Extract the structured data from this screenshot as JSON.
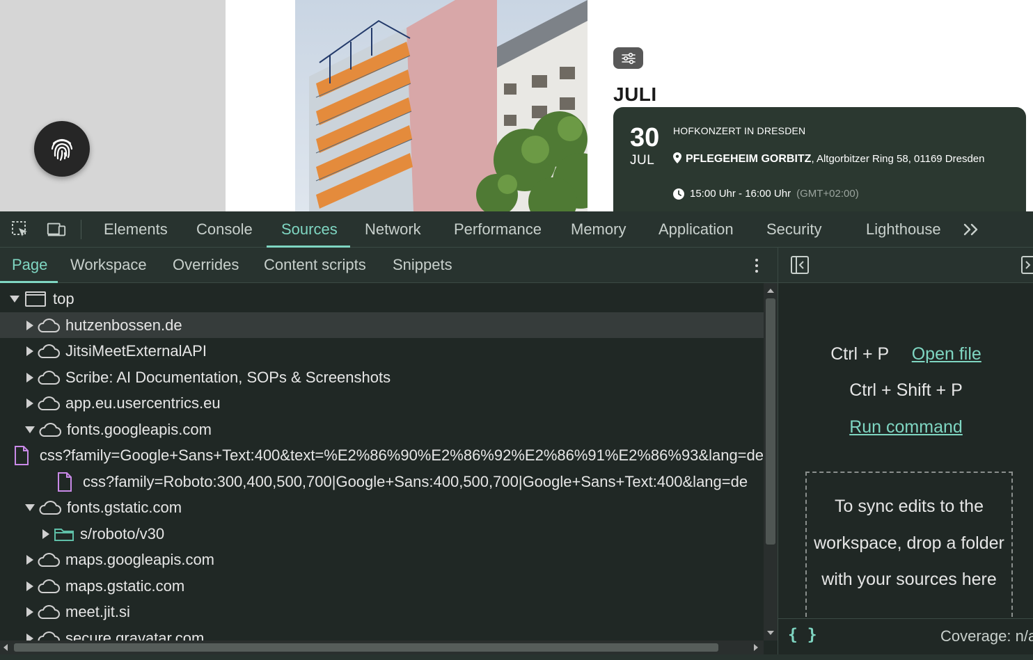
{
  "webpage": {
    "month_heading": "JULI",
    "event": {
      "day": "30",
      "month": "JUL",
      "title": "HOFKONZERT IN DRESDEN",
      "venue": "PFLEGEHEIM GORBITZ",
      "address": ", Altgorbitzer Ring 58, 01169 Dresden",
      "time": "15:00 Uhr - 16:00 Uhr",
      "timezone": "(GMT+02:00)"
    }
  },
  "devtools": {
    "main_tabs": [
      "Elements",
      "Console",
      "Sources",
      "Network",
      "Performance",
      "Memory",
      "Application",
      "Security",
      "Lighthouse"
    ],
    "active_main_tab": "Sources",
    "sub_tabs": [
      "Page",
      "Workspace",
      "Overrides",
      "Content scripts",
      "Snippets"
    ],
    "active_sub_tab": "Page",
    "tree": [
      {
        "label": "top",
        "expand": "down",
        "icon": "frame-icon"
      },
      {
        "label": "hutzenbossen.de",
        "expand": "right",
        "icon": "cloud-icon",
        "selected": true
      },
      {
        "label": "JitsiMeetExternalAPI",
        "expand": "right",
        "icon": "cloud-icon"
      },
      {
        "label": "Scribe: AI Documentation, SOPs & Screenshots",
        "expand": "right",
        "icon": "cloud-icon"
      },
      {
        "label": "app.eu.usercentrics.eu",
        "expand": "right",
        "icon": "cloud-icon"
      },
      {
        "label": "fonts.googleapis.com",
        "expand": "down",
        "icon": "cloud-icon"
      },
      {
        "label": "css?family=Google+Sans+Text:400&text=%E2%86%90%E2%86%92%E2%86%91%E2%86%93&lang=de",
        "expand": "none",
        "icon": "file-icon"
      },
      {
        "label": "css?family=Roboto:300,400,500,700|Google+Sans:400,500,700|Google+Sans+Text:400&lang=de",
        "expand": "none",
        "icon": "file-icon"
      },
      {
        "label": "fonts.gstatic.com",
        "expand": "down",
        "icon": "cloud-icon"
      },
      {
        "label": "s/roboto/v30",
        "expand": "right",
        "icon": "folder-icon"
      },
      {
        "label": "maps.googleapis.com",
        "expand": "right",
        "icon": "cloud-icon"
      },
      {
        "label": "maps.gstatic.com",
        "expand": "right",
        "icon": "cloud-icon"
      },
      {
        "label": "meet.jit.si",
        "expand": "right",
        "icon": "cloud-icon"
      },
      {
        "label": "secure.gravatar.com",
        "expand": "right",
        "icon": "cloud-icon"
      }
    ],
    "right_pane": {
      "open_file_shortcut": "Ctrl + P",
      "open_file_link": "Open file",
      "run_command_shortcut": "Ctrl + Shift + P",
      "run_command_link": "Run command",
      "drop_text": "To sync edits to the workspace, drop a folder with your sources here",
      "coverage": "Coverage: n/a"
    },
    "colors": {
      "accent": "#7fd6c2",
      "background": "#202825",
      "toolbar": "#28332f",
      "event_card": "#2b3830"
    }
  }
}
